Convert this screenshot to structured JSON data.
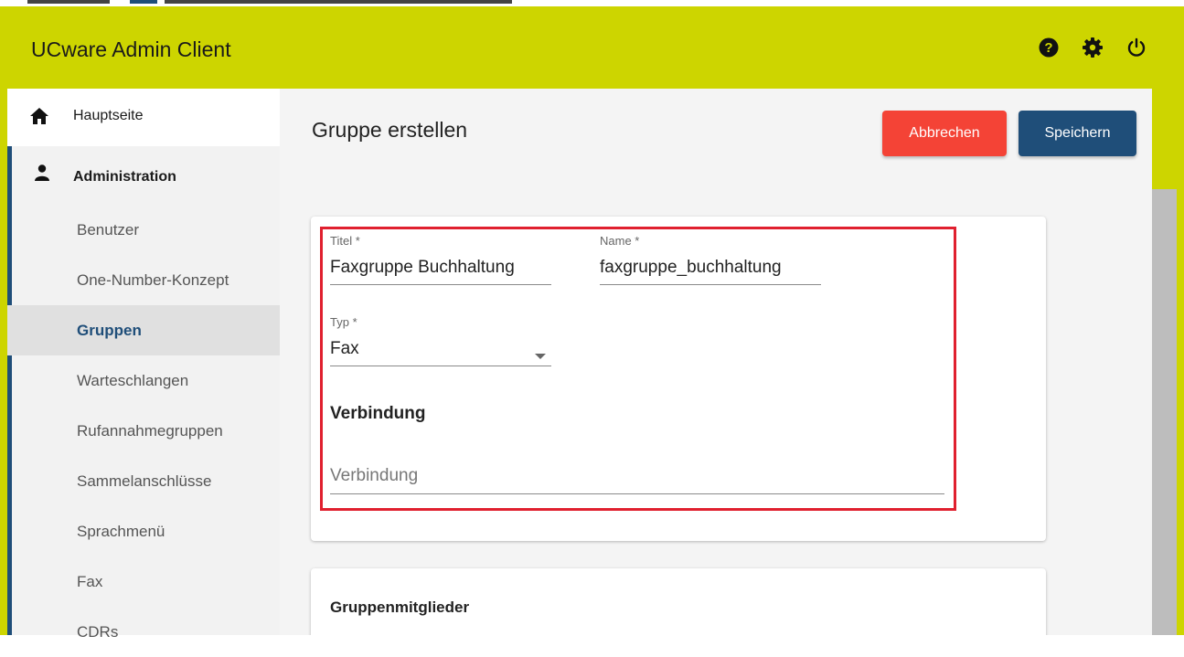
{
  "app": {
    "title": "UCware Admin Client"
  },
  "header_icons": [
    "help-icon",
    "settings-icon",
    "power-icon"
  ],
  "sidebar": {
    "home": {
      "label": "Hauptseite",
      "icon": "home-icon"
    },
    "admin": {
      "label": "Administration",
      "icon": "person-icon"
    },
    "items": [
      {
        "label": "Benutzer"
      },
      {
        "label": "One-Number-Konzept"
      },
      {
        "label": "Gruppen",
        "active": true
      },
      {
        "label": "Warteschlangen"
      },
      {
        "label": "Rufannahmegruppen"
      },
      {
        "label": "Sammelanschlüsse"
      },
      {
        "label": "Sprachmenü"
      },
      {
        "label": "Fax"
      },
      {
        "label": "CDRs"
      }
    ]
  },
  "main": {
    "title": "Gruppe erstellen",
    "cancel_label": "Abbrechen",
    "save_label": "Speichern"
  },
  "form": {
    "titel_label": "Titel *",
    "titel_value": "Faxgruppe Buchhaltung",
    "name_label": "Name *",
    "name_value": "faxgruppe_buchhaltung",
    "typ_label": "Typ *",
    "typ_value": "Fax",
    "section_verbindung": "Verbindung",
    "verbindung_placeholder": "Verbindung"
  },
  "members_card": {
    "title": "Gruppenmitglieder"
  },
  "colors": {
    "header_bg": "#cdd500",
    "primary": "#1f4e79",
    "cancel": "#f44336",
    "highlight": "#e0202f"
  }
}
